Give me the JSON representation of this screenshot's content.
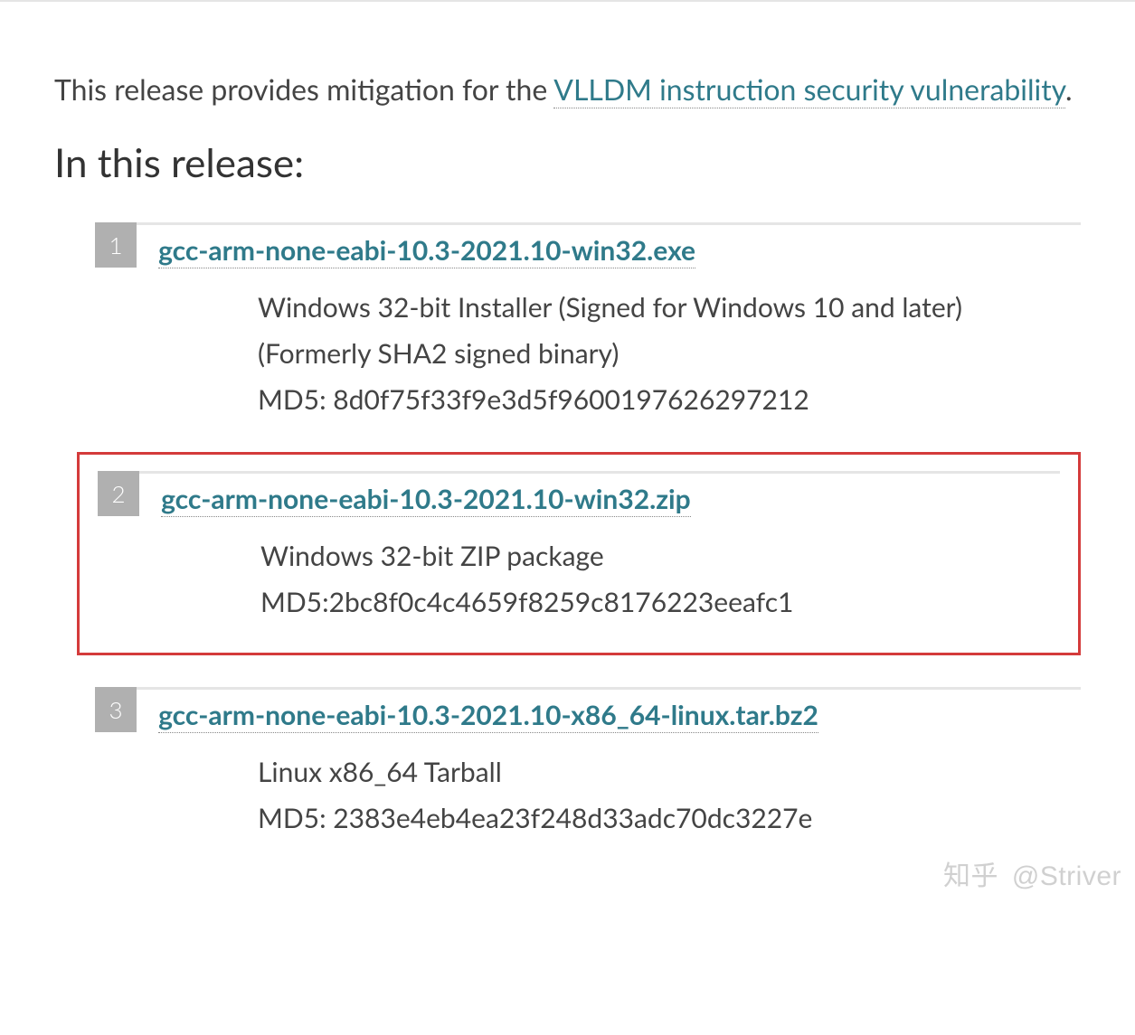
{
  "intro": {
    "prefix": "This release provides mitigation for the ",
    "link_text": "VLLDM instruction security vulnerability",
    "suffix": "."
  },
  "section_heading": "In this release:",
  "items": [
    {
      "num": "1",
      "file": "gcc-arm-none-eabi-10.3-2021.10-win32.exe",
      "desc1": "Windows 32-bit Installer (Signed for Windows 10 and later) (Formerly SHA2 signed binary)",
      "md5": "MD5: 8d0f75f33f9e3d5f9600197626297212",
      "highlight": false
    },
    {
      "num": "2",
      "file": "gcc-arm-none-eabi-10.3-2021.10-win32.zip",
      "desc1": "Windows 32-bit ZIP package",
      "md5": "MD5:2bc8f0c4c4659f8259c8176223eeafc1",
      "highlight": true
    },
    {
      "num": "3",
      "file": "gcc-arm-none-eabi-10.3-2021.10-x86_64-linux.tar.bz2",
      "desc1": "Linux x86_64 Tarball",
      "md5": "MD5: 2383e4eb4ea23f248d33adc70dc3227e",
      "highlight": false
    }
  ],
  "watermark": {
    "logo": "知乎",
    "author": "@Striver"
  }
}
